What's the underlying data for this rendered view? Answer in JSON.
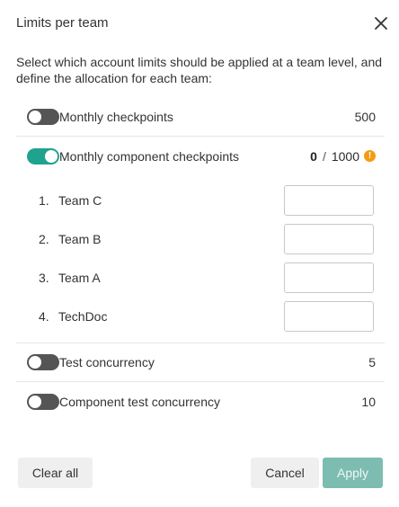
{
  "dialog": {
    "title": "Limits per team",
    "description": "Select which account limits should be applied at a team level, and define the allocation for each team:"
  },
  "limits": [
    {
      "label": "Monthly checkpoints",
      "value": "500",
      "enabled": false
    },
    {
      "label": "Monthly component checkpoints",
      "used": "0",
      "separator": "/",
      "total": "1000",
      "enabled": true
    },
    {
      "label": "Test concurrency",
      "value": "5",
      "enabled": false
    },
    {
      "label": "Component test concurrency",
      "value": "10",
      "enabled": false
    }
  ],
  "teams": [
    {
      "index": "1.",
      "name": "Team C",
      "value": ""
    },
    {
      "index": "2.",
      "name": "Team B",
      "value": ""
    },
    {
      "index": "3.",
      "name": "Team A",
      "value": ""
    },
    {
      "index": "4.",
      "name": "TechDoc",
      "value": ""
    }
  ],
  "footer": {
    "clear_label": "Clear all",
    "cancel_label": "Cancel",
    "apply_label": "Apply"
  },
  "colors": {
    "toggle_on": "#1fa38e",
    "toggle_off": "#555555",
    "warning": "#f39c12",
    "apply_disabled": "#7dbcb1"
  },
  "icons": {
    "close": "close-icon",
    "warning": "warning-icon"
  }
}
